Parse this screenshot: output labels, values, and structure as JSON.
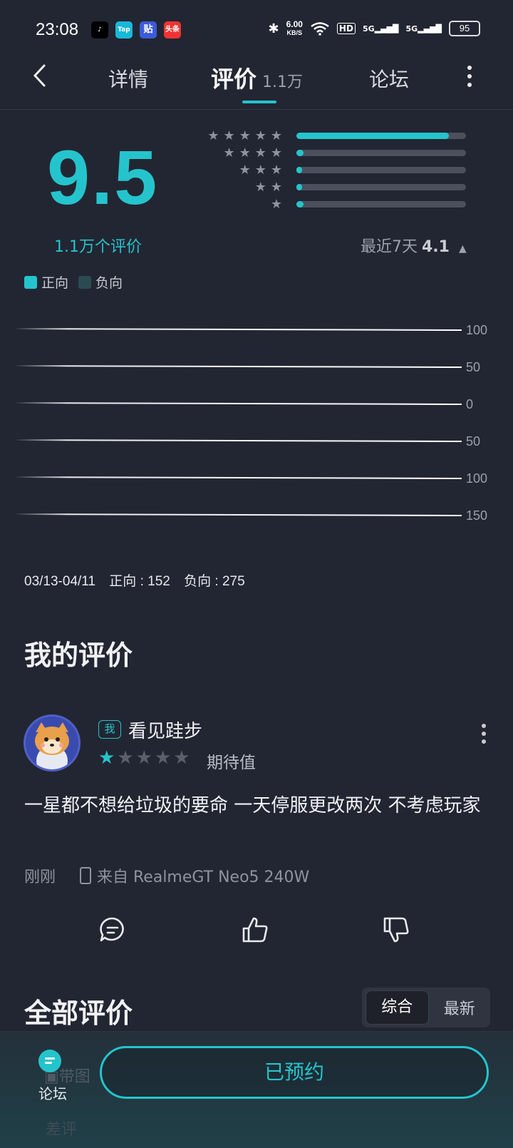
{
  "status_bar": {
    "time": "23:08",
    "net_speed_value": "6.00",
    "net_speed_unit": "KB/S",
    "hd_label": "HD",
    "sim1_label": "5G",
    "sim2_label": "5G",
    "battery": "95",
    "app_icons": [
      "douyin-icon",
      "taptap-icon",
      "tieba-icon",
      "toutiao-icon"
    ],
    "taptap_label": "Tap",
    "tieba_label": "贴",
    "toutiao_label": "头条"
  },
  "nav": {
    "tabs": [
      {
        "label": "详情"
      },
      {
        "label": "评价",
        "count": "1.1万"
      },
      {
        "label": "论坛"
      }
    ],
    "active_tab": "评价"
  },
  "rating": {
    "score": "9.5",
    "review_count_text": "1.1万个评价",
    "recent_label": "最近7天",
    "recent_score": "4.1",
    "star_distribution": [
      {
        "stars": 5,
        "fraction": 0.9
      },
      {
        "stars": 4,
        "fraction": 0.04
      },
      {
        "stars": 3,
        "fraction": 0.015
      },
      {
        "stars": 2,
        "fraction": 0.012
      },
      {
        "stars": 1,
        "fraction": 0.04
      }
    ]
  },
  "legend": {
    "positive": "正向",
    "negative": "负向",
    "positive_color": "#25c4cc",
    "negative_color": "#2c4a52"
  },
  "chart_data": {
    "type": "bar",
    "y_tick_labels": [
      "100",
      "50",
      "0",
      "50",
      "100",
      "150"
    ],
    "series": [
      {
        "name": "正向",
        "values": []
      },
      {
        "name": "负向",
        "values": []
      }
    ]
  },
  "summary": {
    "date_range": "03/13-04/11",
    "positive_text": "正向 : 152",
    "negative_text": "负向 : 275"
  },
  "my_review": {
    "section_title": "我的评价",
    "me_badge": "我",
    "username": "看见跬步",
    "rating": 1,
    "max_rating": 5,
    "tag": "期待值",
    "text": "一星都不想给垃圾的要命 一天停服更改两次 不考虑玩家",
    "time": "刚刚",
    "device": "来自 RealmeGT Neo5 240W"
  },
  "all_reviews": {
    "section_title": "全部评价",
    "sort_options": [
      "综合",
      "最新"
    ],
    "active_sort": "综合",
    "filter_partial_1": "带图",
    "filter_partial_2": "差评"
  },
  "bottom_bar": {
    "forum_label": "论坛",
    "reserve_label": "已预约"
  }
}
